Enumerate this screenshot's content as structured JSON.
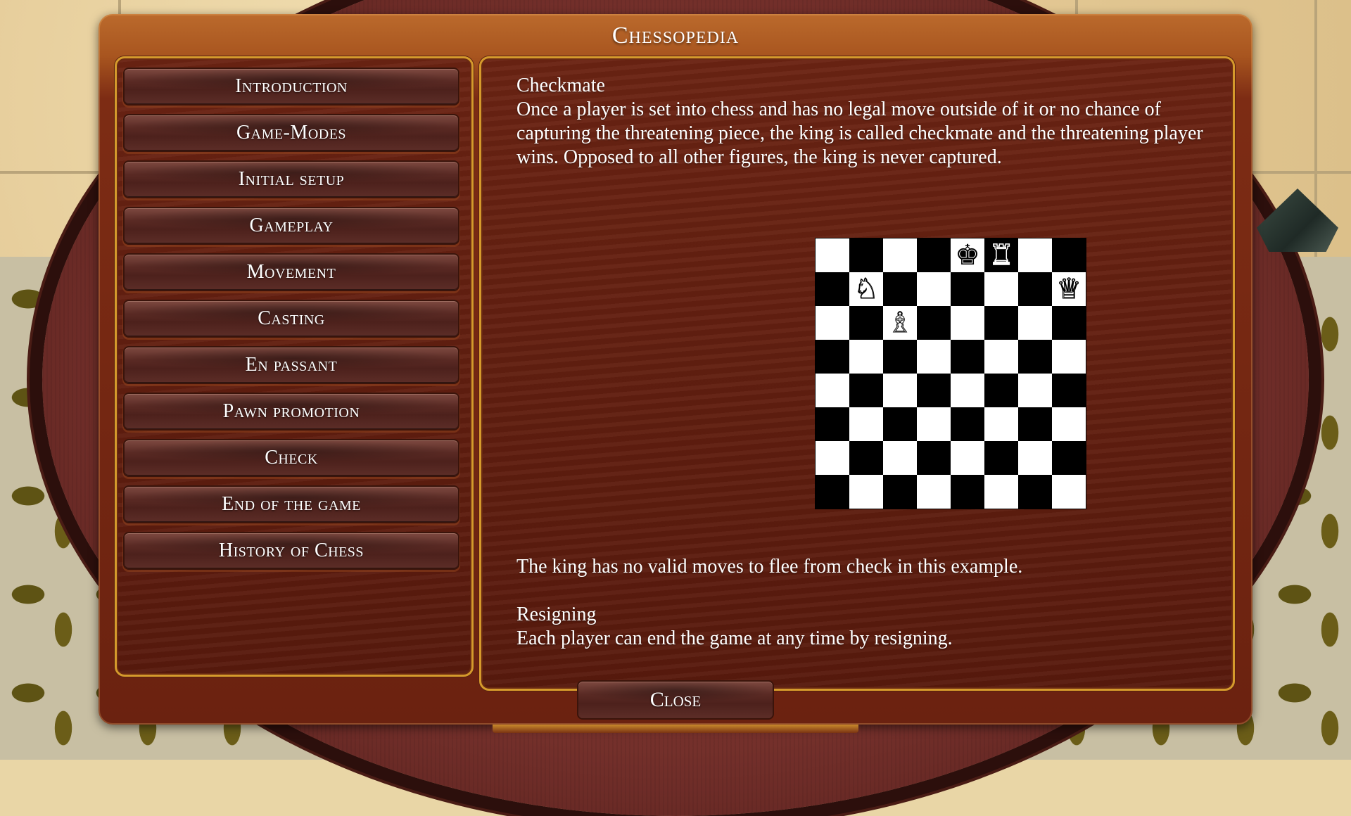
{
  "window": {
    "title": "Chessopedia"
  },
  "sidebar": {
    "items": [
      {
        "id": "introduction",
        "label": "Introduction"
      },
      {
        "id": "game-modes",
        "label": "Game-Modes"
      },
      {
        "id": "initial-setup",
        "label": "Initial setup"
      },
      {
        "id": "gameplay",
        "label": "Gameplay"
      },
      {
        "id": "movement",
        "label": "Movement"
      },
      {
        "id": "casting",
        "label": "Casting"
      },
      {
        "id": "en-passant",
        "label": "En passant"
      },
      {
        "id": "pawn-promotion",
        "label": "Pawn promotion"
      },
      {
        "id": "check",
        "label": "Check"
      },
      {
        "id": "end-of-the-game",
        "label": "End of the game"
      },
      {
        "id": "history-of-chess",
        "label": "History of Chess"
      }
    ]
  },
  "content": {
    "section1_heading": "Checkmate",
    "section1_body": "Once a player is set into chess and has no legal move outside of it or no chance of capturing the threatening piece, the king is called checkmate and the threatening player wins. Opposed to all other figures, the king is never captured.",
    "diagram_caption": "The king has no valid moves to flee from check in this example.",
    "section2_heading": "Resigning",
    "section2_body": "Each player can end the game at any time by resigning.",
    "board": {
      "top_left_square": "light",
      "pieces": [
        {
          "square": "e8",
          "piece": "king",
          "color": "black",
          "glyph": "♚"
        },
        {
          "square": "f8",
          "piece": "rook",
          "color": "white",
          "glyph": "♜"
        },
        {
          "square": "b7",
          "piece": "knight",
          "color": "white",
          "glyph": "♘"
        },
        {
          "square": "h7",
          "piece": "queen",
          "color": "white",
          "glyph": "♕"
        },
        {
          "square": "c6",
          "piece": "bishop",
          "color": "white",
          "glyph": "♗"
        }
      ]
    }
  },
  "scrollbar": {
    "thumb_start_fraction": 0.04,
    "thumb_size_fraction": 0.51
  },
  "footer": {
    "close_label": "Close"
  },
  "colors": {
    "gold_border": "#d59a2c",
    "header_wood": "#b0622a",
    "inner_wood": "#5e1d0f",
    "button_brown": "#5a2a24",
    "text": "#ffffff"
  }
}
